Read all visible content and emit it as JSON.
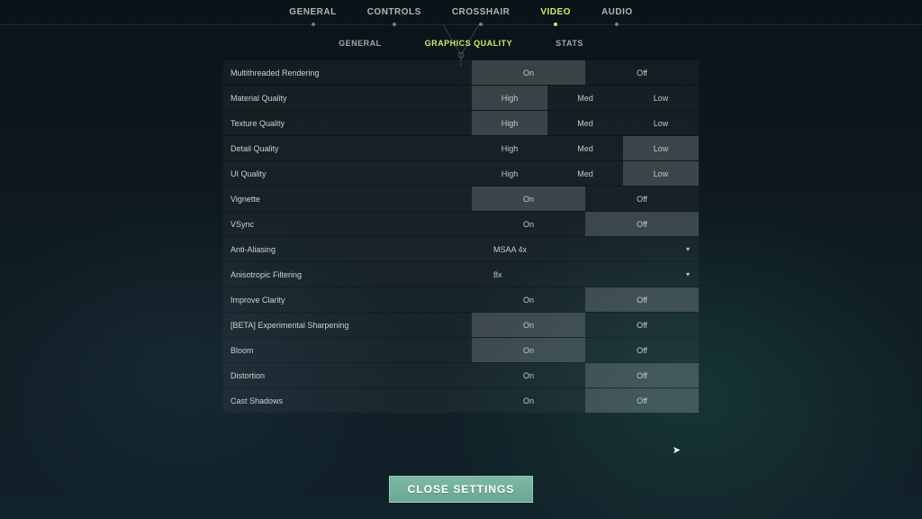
{
  "tabs": {
    "items": [
      "GENERAL",
      "CONTROLS",
      "CROSSHAIR",
      "VIDEO",
      "AUDIO"
    ],
    "active": "VIDEO"
  },
  "subtabs": {
    "items": [
      "GENERAL",
      "GRAPHICS QUALITY",
      "STATS"
    ],
    "active": "GRAPHICS QUALITY"
  },
  "options": {
    "two": [
      "On",
      "Off"
    ],
    "three": [
      "High",
      "Med",
      "Low"
    ]
  },
  "rows": [
    {
      "key": "multithreaded",
      "label": "Multithreaded Rendering",
      "type": "two",
      "selected": "On"
    },
    {
      "key": "material",
      "label": "Material Quality",
      "type": "three",
      "selected": "High"
    },
    {
      "key": "texture",
      "label": "Texture Quality",
      "type": "three",
      "selected": "High"
    },
    {
      "key": "detail",
      "label": "Detail Quality",
      "type": "three",
      "selected": "Low"
    },
    {
      "key": "ui",
      "label": "UI Quality",
      "type": "three",
      "selected": "Low"
    },
    {
      "key": "vignette",
      "label": "Vignette",
      "type": "two",
      "selected": "On"
    },
    {
      "key": "vsync",
      "label": "VSync",
      "type": "two",
      "selected": "Off"
    },
    {
      "key": "aa",
      "label": "Anti-Aliasing",
      "type": "dropdown",
      "value": "MSAA 4x"
    },
    {
      "key": "aniso",
      "label": "Anisotropic Filtering",
      "type": "dropdown",
      "value": "8x"
    },
    {
      "key": "clarity",
      "label": "Improve Clarity",
      "type": "two",
      "selected": "Off"
    },
    {
      "key": "sharpen",
      "label": "[BETA] Experimental Sharpening",
      "type": "two",
      "selected": "On"
    },
    {
      "key": "bloom",
      "label": "Bloom",
      "type": "two",
      "selected": "On"
    },
    {
      "key": "distortion",
      "label": "Distortion",
      "type": "two",
      "selected": "Off"
    },
    {
      "key": "shadows",
      "label": "Cast Shadows",
      "type": "two",
      "selected": "Off"
    }
  ],
  "close_label": "CLOSE SETTINGS"
}
